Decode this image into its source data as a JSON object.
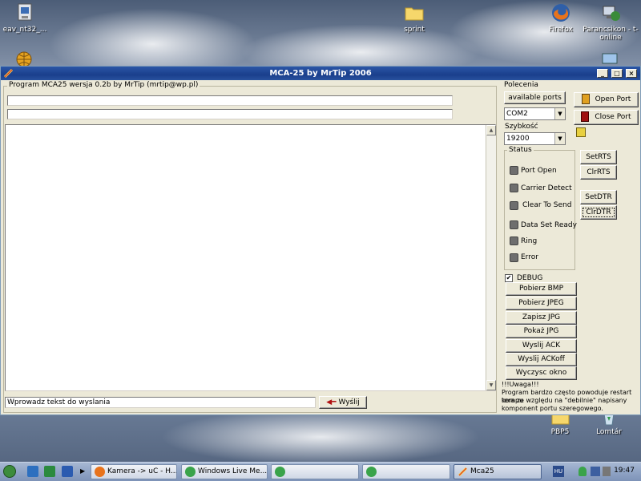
{
  "desktop": {
    "icons": [
      {
        "label": "eav_nt32_...",
        "icon": "eav-installer-icon"
      },
      {
        "label": "sprint",
        "icon": "folder-icon"
      },
      {
        "label": "Firefox",
        "icon": "firefox-icon"
      },
      {
        "label": "Parancsikon - t-online",
        "icon": "network-shortcut-icon"
      },
      {
        "label": "PBP5",
        "icon": "folder-icon"
      },
      {
        "label": "Lomtár",
        "icon": "recycle-bin-icon"
      }
    ]
  },
  "window": {
    "title": "MCA-25 by MrTip 2006",
    "controls": {
      "minimize": "_",
      "maximize": "□",
      "close": "×"
    },
    "program_group_label": "Program MCA25 wersja 0.2b by MrTip (mrtip@wp.pl)",
    "field1_value": "",
    "field2_value": "",
    "log_value": "",
    "send_input_value": "Wprowadz tekst do wyslania",
    "send_button": "Wyślij",
    "commands": {
      "group_label": "Polecenia",
      "available_ports_button": "available ports",
      "port_select": "COM2",
      "speed_label": "Szybkość",
      "speed_select": "19200",
      "open_port": "Open Port",
      "close_port": "Close Port"
    },
    "status": {
      "group_label": "Status",
      "items": [
        "Port Open",
        "Carrier Detect",
        "Clear To Send",
        "Data Set Ready",
        "Ring",
        "Error"
      ]
    },
    "line_buttons": {
      "setrts": "SetRTS",
      "clrrts": "ClrRTS",
      "setdtr": "SetDTR",
      "clrdtr": "ClrDTR"
    },
    "debug": {
      "label": "DEBUG",
      "checked": true,
      "checkmark": "✔",
      "buttons": [
        "Pobierz BMP",
        "Pobierz JPEG",
        "Zapisz JPG",
        "Pokaż JPG",
        "Wyslij ACK",
        "Wyslij ACKoff",
        "Wyczysc okno"
      ]
    },
    "notes": {
      "heading": "!!!Uwaga!!!",
      "line1": "Program bardzo często powoduje restart kompu",
      "line2": "tera ze względu na \"debilnie\" napisany",
      "line3": "komponent portu szeregowego."
    }
  },
  "taskbar": {
    "tasks": [
      {
        "label": "Kamera -> uC - H...",
        "active": false
      },
      {
        "label": "Windows Live Me...",
        "active": false
      },
      {
        "label": "",
        "active": false
      },
      {
        "label": "",
        "active": false
      },
      {
        "label": "Mca25",
        "active": true
      }
    ],
    "language": "HU",
    "clock": "19:47"
  },
  "colors": {
    "titlebar": "#1a3f8c",
    "window_bg": "#ece9d8",
    "led_off": "#6e6e6e",
    "send_arrow": "#b01010"
  }
}
